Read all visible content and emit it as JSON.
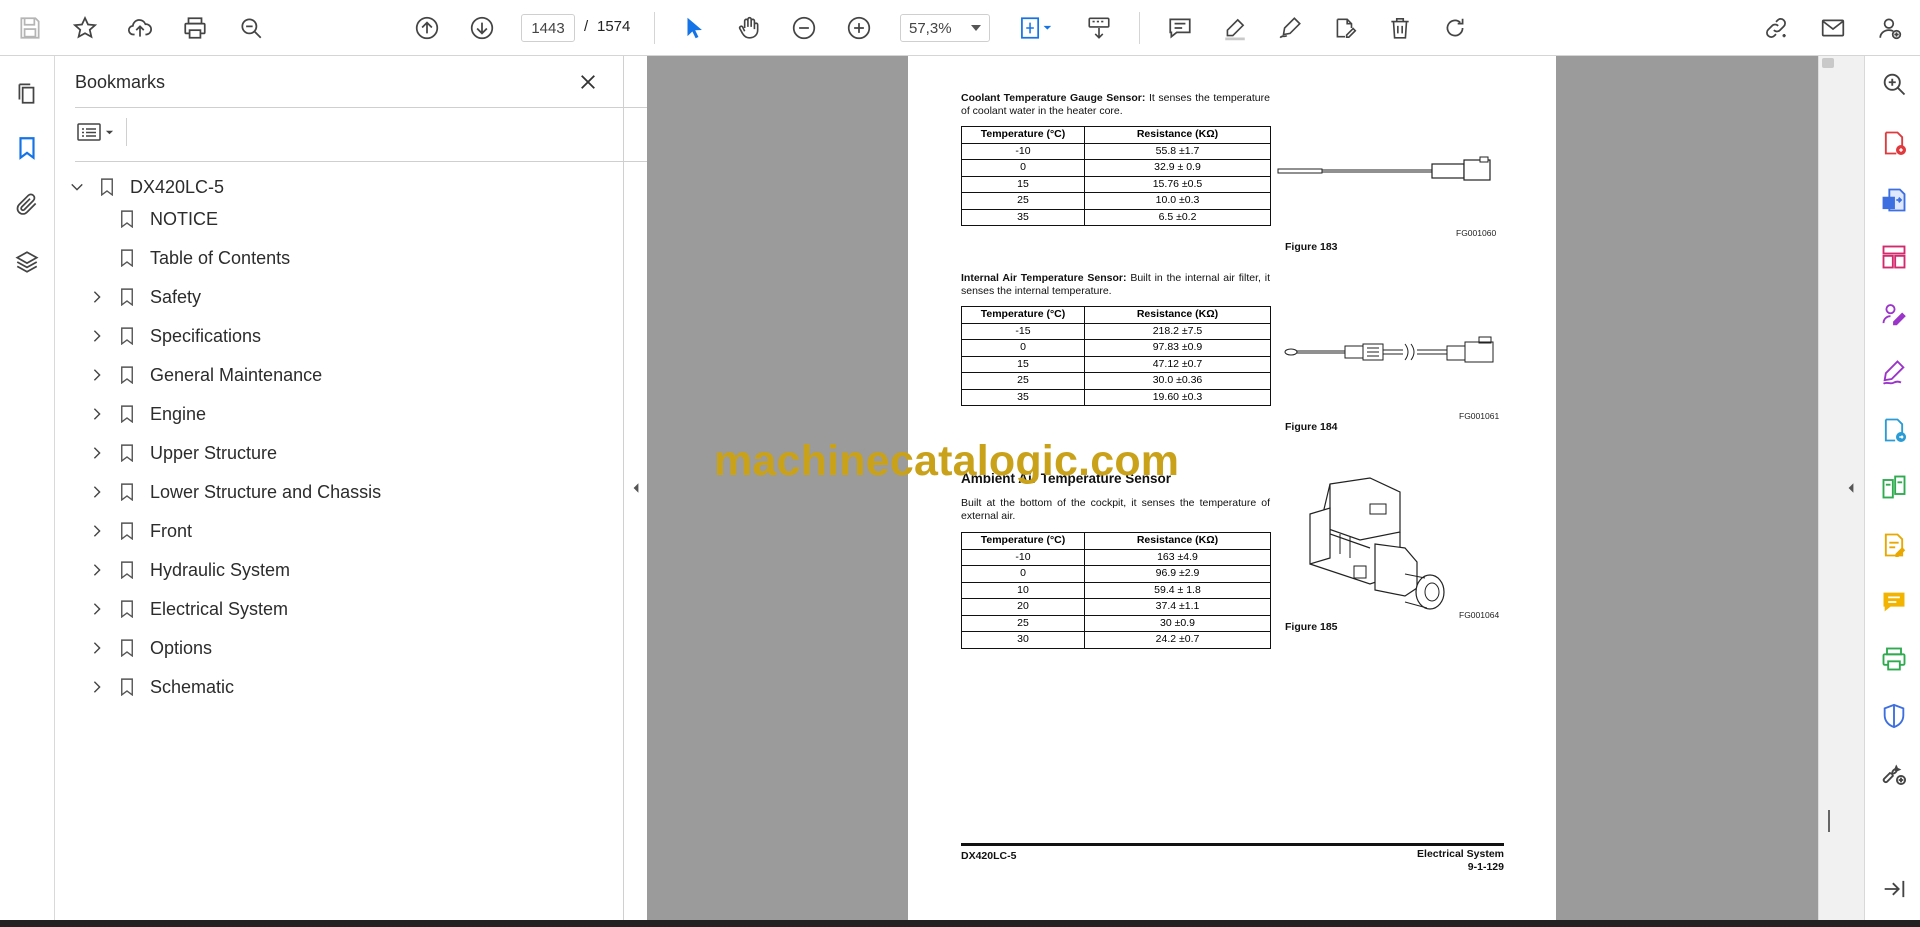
{
  "toolbar": {
    "current_page": "1443",
    "page_separator": "/",
    "total_pages": "1574",
    "zoom": "57,3%"
  },
  "bookmarks": {
    "title": "Bookmarks",
    "root": "DX420LC-5",
    "items": [
      {
        "label": "NOTICE",
        "expandable": false
      },
      {
        "label": "Table of Contents",
        "expandable": false
      },
      {
        "label": "Safety",
        "expandable": true
      },
      {
        "label": "Specifications",
        "expandable": true
      },
      {
        "label": "General Maintenance",
        "expandable": true
      },
      {
        "label": "Engine",
        "expandable": true
      },
      {
        "label": "Upper Structure",
        "expandable": true
      },
      {
        "label": "Lower Structure and Chassis",
        "expandable": true
      },
      {
        "label": "Front",
        "expandable": true
      },
      {
        "label": "Hydraulic System",
        "expandable": true
      },
      {
        "label": "Electrical System",
        "expandable": true
      },
      {
        "label": "Options",
        "expandable": true
      },
      {
        "label": "Schematic",
        "expandable": true
      }
    ]
  },
  "document": {
    "coolant": {
      "title": "Coolant Temperature Gauge Sensor:",
      "text": " It senses the temperature of coolant water in the heater core.",
      "col1": "Temperature (°C)",
      "col2": "Resistance (KΩ)",
      "rows": [
        [
          "-10",
          "55.8 ±1.7"
        ],
        [
          "0",
          "32.9 ± 0.9"
        ],
        [
          "15",
          "15.76 ±0.5"
        ],
        [
          "25",
          "10.0 ±0.3"
        ],
        [
          "35",
          "6.5 ±0.2"
        ]
      ],
      "fig_code": "FG001060",
      "fig_caption": "Figure 183"
    },
    "internal": {
      "title": "Internal Air Temperature Sensor:",
      "text": " Built in the internal air filter, it senses the internal temperature.",
      "col1": "Temperature (°C)",
      "col2": "Resistance (KΩ)",
      "rows": [
        [
          "-15",
          "218.2 ±7.5"
        ],
        [
          "0",
          "97.83 ±0.9"
        ],
        [
          "15",
          "47.12 ±0.7"
        ],
        [
          "25",
          "30.0 ±0.36"
        ],
        [
          "35",
          "19.60 ±0.3"
        ]
      ],
      "fig_code": "FG001061",
      "fig_caption": "Figure 184"
    },
    "ambient": {
      "heading": "Ambient Air Temperature Sensor",
      "text": "Built at the bottom of the cockpit, it senses the temperature of external air.",
      "col1": "Temperature (°C)",
      "col2": "Resistance (KΩ)",
      "rows": [
        [
          "-10",
          "163 ±4.9"
        ],
        [
          "0",
          "96.9 ±2.9"
        ],
        [
          "10",
          "59.4 ± 1.8"
        ],
        [
          "20",
          "37.4 ±1.1"
        ],
        [
          "25",
          "30 ±0.9"
        ],
        [
          "30",
          "24.2 ±0.7"
        ]
      ],
      "fig_code": "FG001064",
      "fig_caption": "Figure 185"
    },
    "footer_left": "DX420LC-5",
    "footer_right_1": "Electrical System",
    "footer_right_2": "9-1-129",
    "watermark": "machinecatalogic.com"
  },
  "colors": {
    "accent": "#1473e6",
    "viewport_bg": "#9b9b9b",
    "watermark": "#c9a21a"
  }
}
